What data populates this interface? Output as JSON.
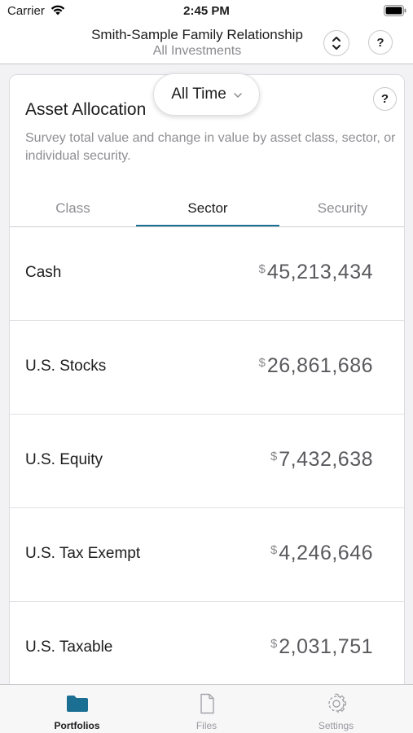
{
  "status_bar": {
    "carrier": "Carrier",
    "time": "2:45 PM"
  },
  "header": {
    "title": "Smith-Sample Family Relationship",
    "subtitle": "All Investments",
    "help_label": "?"
  },
  "card": {
    "title": "Asset Allocation",
    "help_label": "?",
    "description": "Survey total value and change in value by asset class, sector, or individual security.",
    "period": {
      "selected": "All Time"
    },
    "tabs": [
      {
        "label": "Class",
        "active": false
      },
      {
        "label": "Sector",
        "active": true
      },
      {
        "label": "Security",
        "active": false
      }
    ],
    "rows": [
      {
        "label": "Cash",
        "currency": "$",
        "amount": "45,213,434"
      },
      {
        "label": "U.S. Stocks",
        "currency": "$",
        "amount": "26,861,686"
      },
      {
        "label": "U.S. Equity",
        "currency": "$",
        "amount": "7,432,638"
      },
      {
        "label": "U.S. Tax Exempt",
        "currency": "$",
        "amount": "4,246,646"
      },
      {
        "label": "U.S. Taxable",
        "currency": "$",
        "amount": "2,031,751"
      }
    ]
  },
  "tabbar": {
    "items": [
      {
        "label": "Portfolios",
        "icon": "folder-icon",
        "active": true
      },
      {
        "label": "Files",
        "icon": "file-icon",
        "active": false
      },
      {
        "label": "Settings",
        "icon": "gear-icon",
        "active": false
      }
    ]
  },
  "colors": {
    "accent": "#1b6f93",
    "muted_text": "#8e8e93",
    "background": "#f2f2f4"
  }
}
